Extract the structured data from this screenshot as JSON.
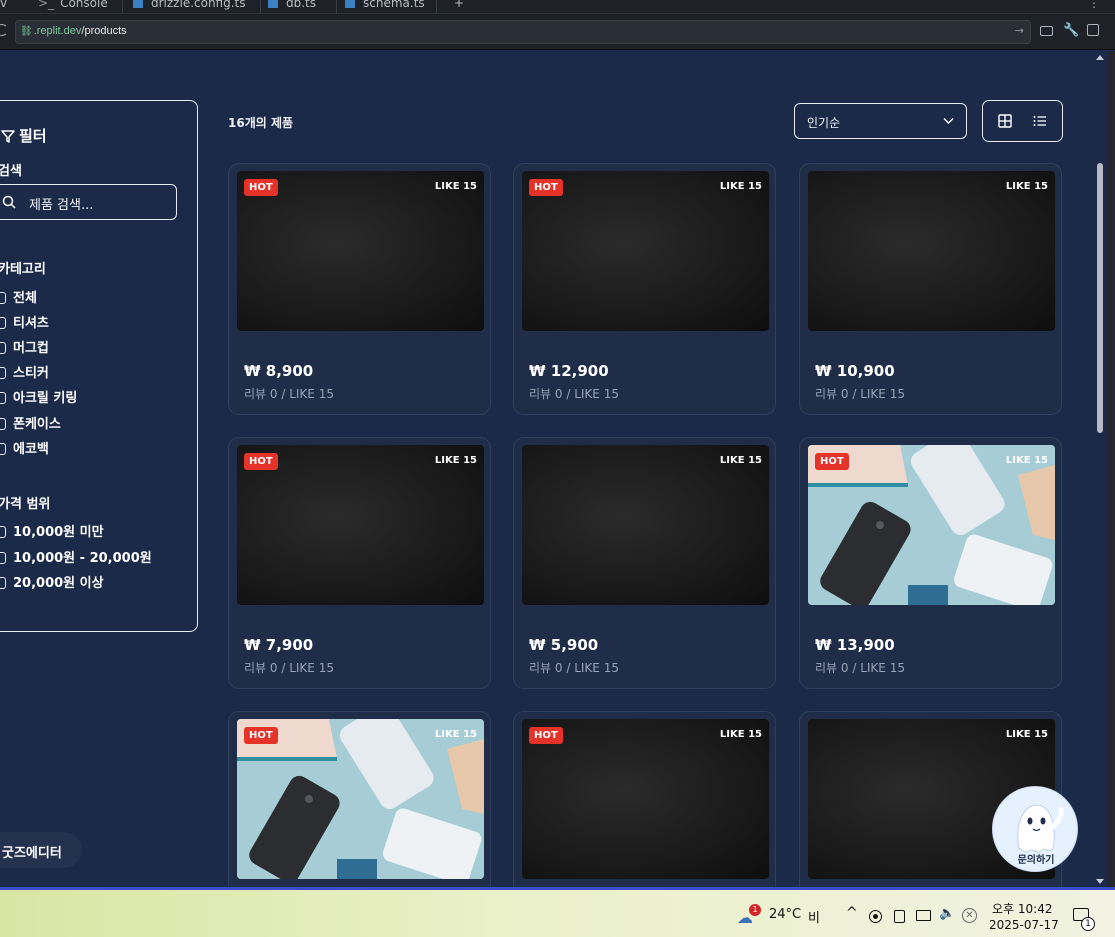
{
  "tabs": {
    "items": [
      "Console",
      "drizzle.config.ts",
      "db.ts",
      "schema.ts"
    ],
    "add_label": "+",
    "leading_label": "v"
  },
  "url": {
    "host": ".replit.dev",
    "path": "/products"
  },
  "filter": {
    "title": "필터",
    "search_section": "검색",
    "search_placeholder": "제품 검색...",
    "category_section": "카테고리",
    "categories": [
      {
        "label": "전체",
        "checked": true
      },
      {
        "label": "티셔츠",
        "checked": false
      },
      {
        "label": "머그컵",
        "checked": false
      },
      {
        "label": "스티커",
        "checked": false
      },
      {
        "label": "아크릴 키링",
        "checked": false
      },
      {
        "label": "폰케이스",
        "checked": false
      },
      {
        "label": "에코백",
        "checked": false
      }
    ],
    "price_section": "가격 범위",
    "price_ranges": [
      "10,000원 미만",
      "10,000원 - 20,000원",
      "20,000원 이상"
    ]
  },
  "list": {
    "count_label": "16개의 제품",
    "sort_value": "인기순"
  },
  "products": [
    {
      "hot": "HOT",
      "like": "LIKE 15",
      "price": "₩ 8,900",
      "meta": "리뷰 0 / LIKE 15",
      "image": "dark-texture"
    },
    {
      "hot": "HOT",
      "like": "LIKE 15",
      "price": "₩ 12,900",
      "meta": "리뷰 0 / LIKE 15",
      "image": "dark-texture"
    },
    {
      "hot": "",
      "like": "LIKE 15",
      "price": "₩ 10,900",
      "meta": "리뷰 0 / LIKE 15",
      "image": "dark-texture"
    },
    {
      "hot": "HOT",
      "like": "LIKE 15",
      "price": "₩ 7,900",
      "meta": "리뷰 0 / LIKE 15",
      "image": "dark-texture"
    },
    {
      "hot": "",
      "like": "LIKE 15",
      "price": "₩ 5,900",
      "meta": "리뷰 0 / LIKE 15",
      "image": "dark-texture"
    },
    {
      "hot": "HOT",
      "like": "LIKE 15",
      "price": "₩ 13,900",
      "meta": "리뷰 0 / LIKE 15",
      "image": "phones"
    },
    {
      "hot": "HOT",
      "like": "LIKE 15",
      "price": "",
      "meta": "",
      "image": "phones"
    },
    {
      "hot": "HOT",
      "like": "LIKE 15",
      "price": "",
      "meta": "",
      "image": "dark-texture"
    },
    {
      "hot": "",
      "like": "LIKE 15",
      "price": "",
      "meta": "",
      "image": "dark-texture"
    }
  ],
  "footer": {
    "editor_label": "굿즈에디터",
    "chat_label": "문의하기"
  },
  "taskbar": {
    "weather_badge": "1",
    "temperature": "24°C",
    "weather_text": "비",
    "time": "오후 10:42",
    "date": "2025-07-17",
    "notification_count": "1"
  },
  "colors": {
    "page_bg": "#1c2a4a",
    "card_bg": "#1f2d48",
    "hot_badge": "#e5332a",
    "muted_text": "#9aa3b6"
  }
}
